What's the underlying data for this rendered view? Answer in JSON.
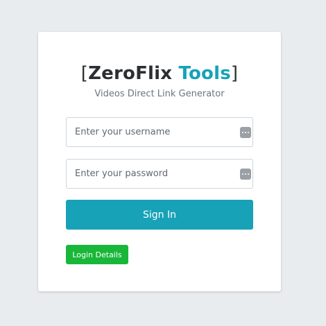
{
  "brand": {
    "open_bracket": "[",
    "name_main": "ZeroFlix",
    "name_accent": "Tools",
    "close_bracket": "]",
    "accent_color": "#17a2b8"
  },
  "subtitle": "Videos Direct Link Generator",
  "form": {
    "username": {
      "placeholder": "Enter your username",
      "value": "",
      "icon": "password-manager-dots-icon"
    },
    "password": {
      "placeholder": "Enter your password",
      "value": "",
      "icon": "password-manager-dots-icon"
    },
    "sign_in_label": "Sign In",
    "sign_in_color": "#17a2b8"
  },
  "login_details_label": "Login Details",
  "login_details_color": "#19b739"
}
